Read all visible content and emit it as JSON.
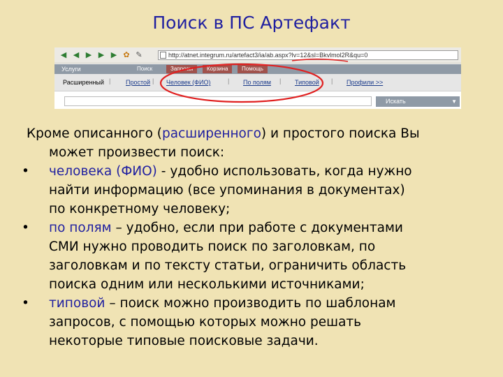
{
  "title": "Поиск в ПС Артефакт",
  "browser": {
    "address": "http://atnet.integrum.ru/artefact3/ia/ab.aspx?lv=12&sl=Bkvlmol2R&qu=0",
    "icons": [
      "back-arrow-icon",
      "forward-arrow-icon",
      "nav-arrow-icon",
      "home-icon",
      "refresh-icon",
      "edit-icon"
    ]
  },
  "menu": {
    "section_label": "Услуги",
    "tabs": [
      "Поиск",
      "Запросы",
      "Корзина",
      "Помощь"
    ]
  },
  "submenu": {
    "items": [
      "Расширенный",
      "Простой",
      "Человек (ФИО)",
      "По полям",
      "Типовой",
      "Профили >>"
    ]
  },
  "search": {
    "button_label": "Искать"
  },
  "colors": {
    "background": "#f0e3b4",
    "title": "#1f1fa0",
    "highlight": "#1f1fa0",
    "annotation": "#e02020"
  },
  "text": {
    "intro_a": "Кроме описанного (",
    "intro_hl": "расширенного",
    "intro_b": ") и простого поиска Вы",
    "intro_c": "может произвести поиск:",
    "b1_hl": "человека (ФИО)",
    "b1_a": " - удобно использовать, когда нужно",
    "b1_b": "найти информацию (все упоминания в документах)",
    "b1_c": "по конкретному человеку;",
    "b2_hl": "по полям",
    "b2_a": " – удобно, если при работе с документами",
    "b2_b": "СМИ нужно проводить поиск по заголовкам, по",
    "b2_c": "заголовкам и по тексту статьи, ограничить область",
    "b2_d": "поиска одним или несколькими источниками;",
    "b3_hl": "типовой",
    "b3_a": " – поиск можно производить по шаблонам",
    "b3_b": "запросов, с помощью которых можно решать",
    "b3_c": "некоторые типовые поисковые задачи.",
    "bullet": "•"
  }
}
